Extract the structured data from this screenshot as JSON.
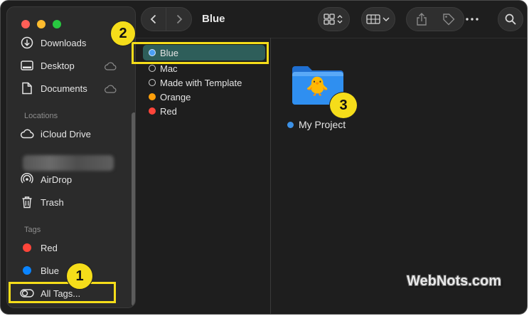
{
  "window": {
    "title": "Blue"
  },
  "sidebar": {
    "favorites": [
      {
        "label": "Downloads",
        "icon": "download-icon"
      },
      {
        "label": "Desktop",
        "icon": "desktop-icon",
        "cloud": true
      },
      {
        "label": "Documents",
        "icon": "document-icon",
        "cloud": true
      }
    ],
    "locations_header": "Locations",
    "locations": [
      {
        "label": "iCloud Drive",
        "icon": "cloud-icon"
      },
      {
        "label": "AirDrop",
        "icon": "airdrop-icon"
      },
      {
        "label": "Trash",
        "icon": "trash-icon"
      }
    ],
    "tags_header": "Tags",
    "tags": [
      {
        "label": "Red",
        "color": "#ff453a"
      },
      {
        "label": "Blue",
        "color": "#0a84ff"
      }
    ],
    "all_tags_label": "All Tags..."
  },
  "column": {
    "items": [
      {
        "label": "Blue",
        "dot_color": "#4a9ff5",
        "selected": true
      },
      {
        "label": "Mac",
        "dot_color": "hollow"
      },
      {
        "label": "Made with Template",
        "dot_color": "hollow"
      },
      {
        "label": "Orange",
        "dot_color": "#ff9f0a"
      },
      {
        "label": "Red",
        "dot_color": "#ff453a"
      }
    ]
  },
  "content": {
    "folder_name": "My Project",
    "folder_tag_color": "#3c91e6",
    "folder_emoji": "🐥"
  },
  "callouts": {
    "one": "1",
    "two": "2",
    "three": "3"
  },
  "watermark": "WebNots.com",
  "colors": {
    "highlight": "#f5dd1a",
    "selection": "#2e5e5a",
    "folder_blue": "#2f8ff0"
  }
}
